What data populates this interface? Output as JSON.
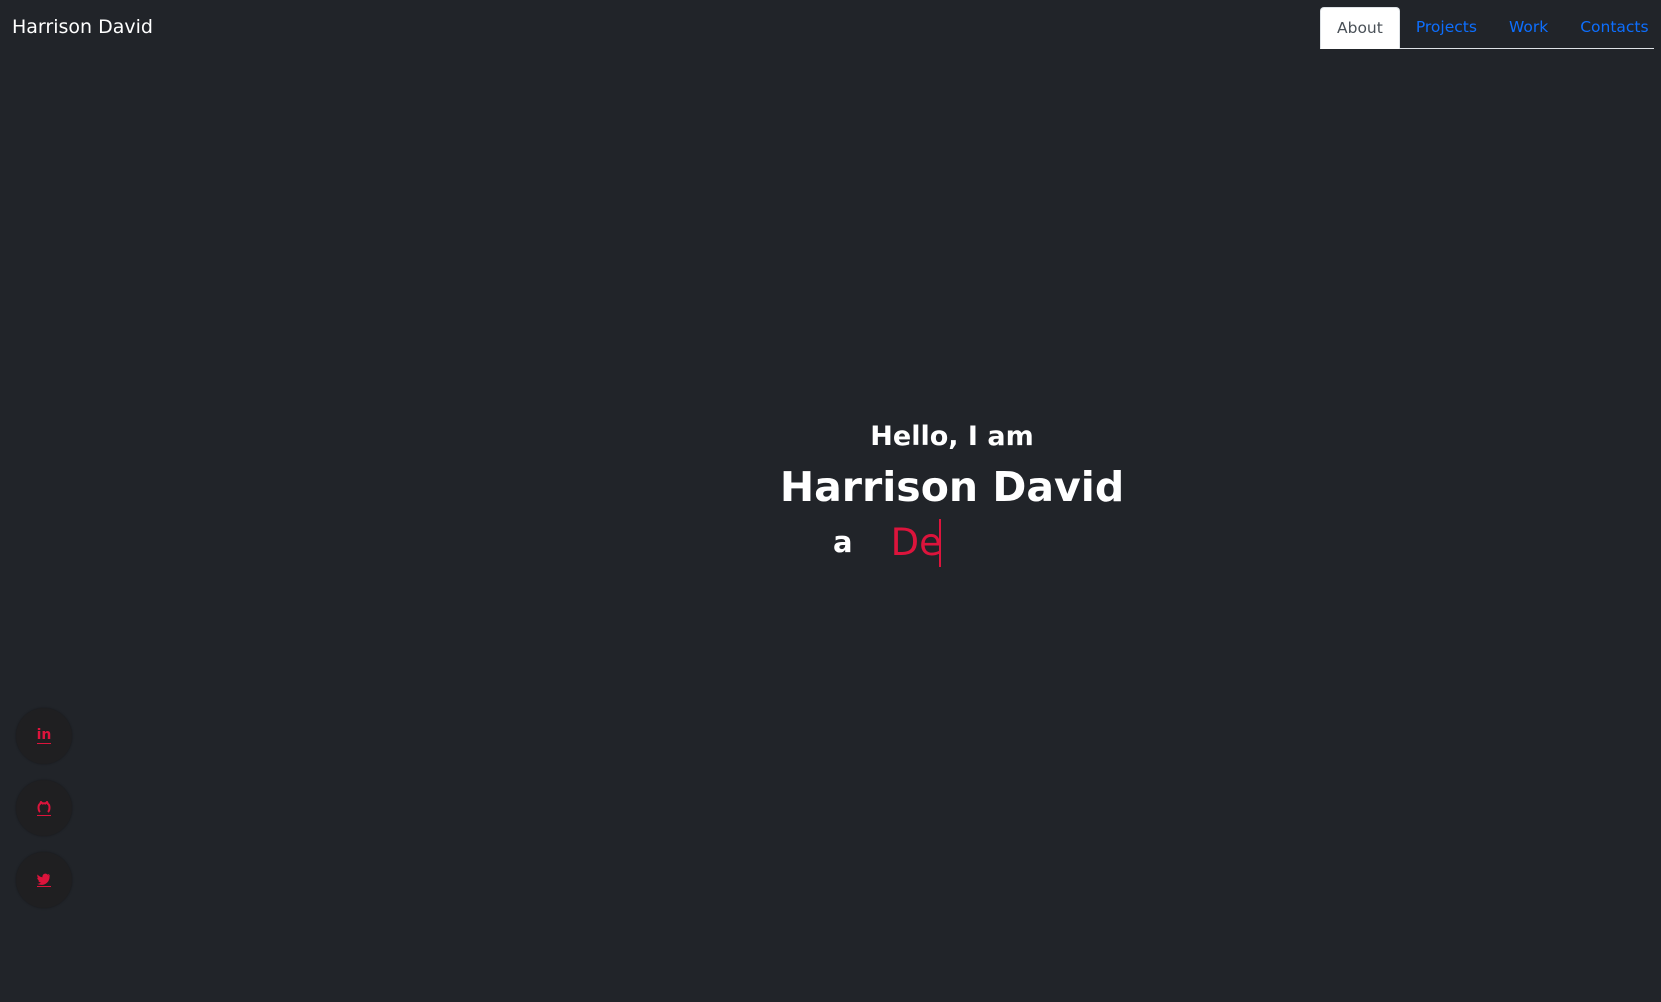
{
  "navbar": {
    "brand": "Harrison David",
    "items": [
      {
        "label": "About",
        "active": true
      },
      {
        "label": "Projects",
        "active": false
      },
      {
        "label": "Work",
        "active": false
      },
      {
        "label": "Contacts",
        "active": false
      }
    ]
  },
  "hero": {
    "greeting": "Hello, I am",
    "name": "Harrison David",
    "prefix": "a",
    "typed_text": "De"
  },
  "social": [
    {
      "icon": "linkedin-icon"
    },
    {
      "icon": "github-icon"
    },
    {
      "icon": "twitter-icon"
    }
  ],
  "colors": {
    "background": "#212429",
    "accent": "#dc143c",
    "link": "#0d6efd"
  }
}
